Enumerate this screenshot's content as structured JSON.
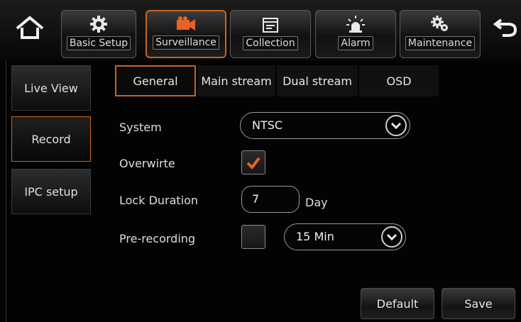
{
  "nav": {
    "home_icon": "home-icon",
    "back_icon": "back-arrow-icon",
    "items": [
      {
        "label": "Basic Setup",
        "icon": "gear-icon"
      },
      {
        "label": "Surveillance",
        "icon": "camera-icon",
        "accent": "#e8612a"
      },
      {
        "label": "Collection",
        "icon": "calendar-icon"
      },
      {
        "label": "Alarm",
        "icon": "alarm-light-icon"
      },
      {
        "label": "Maintenance",
        "icon": "gears-icon"
      }
    ]
  },
  "sidebar": {
    "items": [
      {
        "label": "Live View"
      },
      {
        "label": "Record"
      },
      {
        "label": "IPC setup"
      }
    ]
  },
  "tabs": [
    {
      "label": "General"
    },
    {
      "label": "Main stream"
    },
    {
      "label": "Dual stream"
    },
    {
      "label": "OSD"
    }
  ],
  "form": {
    "system": {
      "label": "System",
      "value": "NTSC"
    },
    "overwrite": {
      "label": "Overwirte",
      "checked": true
    },
    "lock_duration": {
      "label": "Lock Duration",
      "value": "7",
      "unit": "Day"
    },
    "pre_recording": {
      "label": "Pre-recording",
      "checked": false,
      "value": "15 Min"
    }
  },
  "actions": {
    "default_label": "Default",
    "save_label": "Save"
  },
  "colors": {
    "accent": "#c8641e",
    "check": "#e8612a"
  }
}
